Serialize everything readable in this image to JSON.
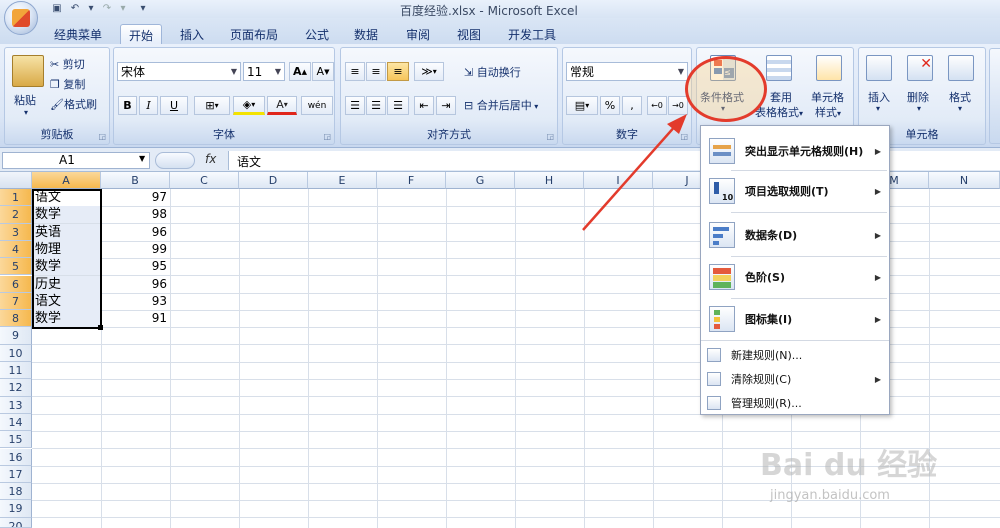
{
  "window": {
    "title": "百度经验.xlsx - Microsoft Excel"
  },
  "tabs": [
    "经典菜单",
    "开始",
    "插入",
    "页面布局",
    "公式",
    "数据",
    "审阅",
    "视图",
    "开发工具"
  ],
  "active_tab": "开始",
  "clipboard": {
    "paste": "粘贴",
    "cut": "剪切",
    "copy": "复制",
    "format_painter": "格式刷",
    "group_label": "剪贴板"
  },
  "font": {
    "font_name": "宋体",
    "font_size": "11",
    "bold": "B",
    "italic": "I",
    "underline": "U",
    "wen": "wén",
    "group_label": "字体"
  },
  "alignment": {
    "wrap_text": "自动换行",
    "merge_center": "合并后居中",
    "group_label": "对齐方式"
  },
  "number": {
    "format": "常规",
    "percent": "%",
    "comma": ",",
    "group_label": "数字"
  },
  "styles": {
    "conditional_format": "条件格式",
    "table_format_1": "套用",
    "table_format_2": "表格格式",
    "cell_style_1": "单元格",
    "cell_style_2": "样式"
  },
  "cells": {
    "insert": "插入",
    "delete": "删除",
    "format": "格式",
    "group_label": "单元格"
  },
  "formula_bar": {
    "name_box": "A1",
    "fx": "fx",
    "content": "语文"
  },
  "columns": [
    "A",
    "B",
    "C",
    "D",
    "E",
    "F",
    "G",
    "H",
    "I",
    "J",
    "K",
    "L",
    "M",
    "N"
  ],
  "rows": [
    "1",
    "2",
    "3",
    "4",
    "5",
    "6",
    "7",
    "8",
    "9",
    "10",
    "11",
    "12",
    "13",
    "14",
    "15",
    "16",
    "17",
    "18",
    "19",
    "20"
  ],
  "data": [
    {
      "subject": "语文",
      "score": "97"
    },
    {
      "subject": "数学",
      "score": "98"
    },
    {
      "subject": "英语",
      "score": "96"
    },
    {
      "subject": "物理",
      "score": "99"
    },
    {
      "subject": "数学",
      "score": "95"
    },
    {
      "subject": "历史",
      "score": "96"
    },
    {
      "subject": "语文",
      "score": "93"
    },
    {
      "subject": "数学",
      "score": "91"
    }
  ],
  "menu": {
    "highlight_rules": "突出显示单元格规则(H)",
    "top_bottom_rules": "项目选取规则(T)",
    "data_bars": "数据条(D)",
    "color_scales": "色阶(S)",
    "icon_sets": "图标集(I)",
    "new_rule": "新建规则(N)...",
    "clear_rules": "清除规则(C)",
    "manage_rules": "管理规则(R)..."
  },
  "watermark": {
    "brand": "Bai du 经验",
    "url": "jingyan.baidu.com"
  },
  "colors": {
    "ribbon": "#dbe6f6",
    "selection_header": "#f6b84e",
    "annotation": "#e33b2c"
  }
}
